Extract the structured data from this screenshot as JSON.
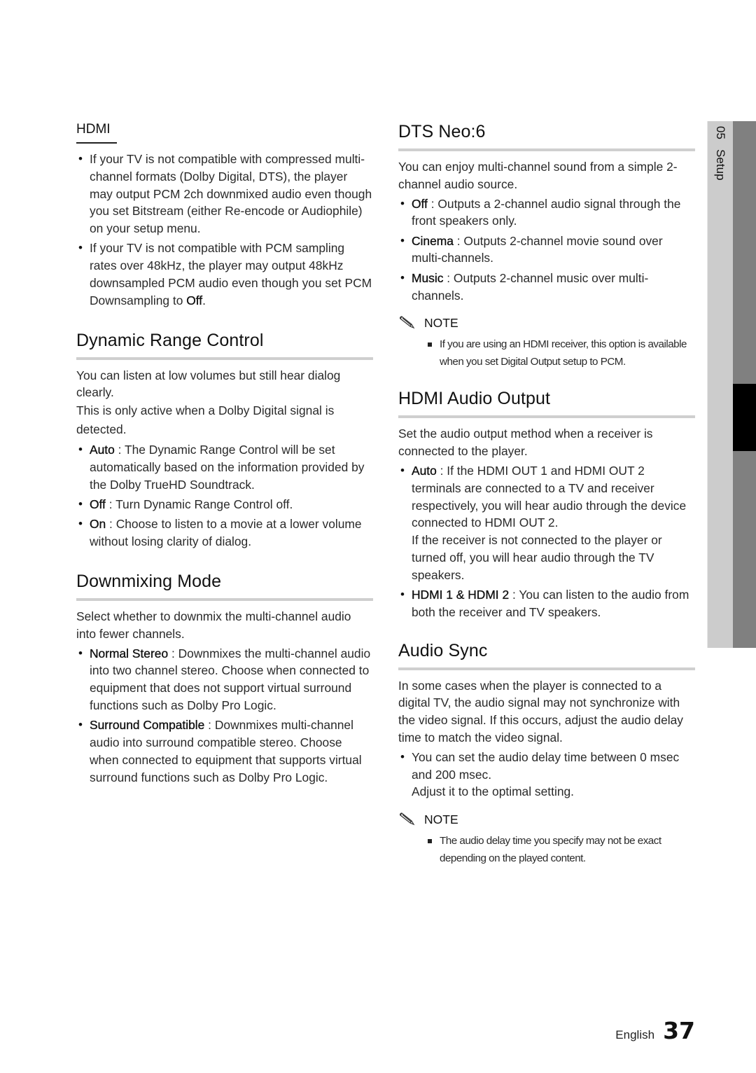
{
  "sidebar": {
    "chapter_number": "05",
    "chapter_title": "Setup"
  },
  "left": {
    "hdmi": {
      "title": "HDMI",
      "bullets": [
        {
          "text": "If your TV is not compatible with compressed multi-channel formats (Dolby Digital, DTS), the player may output PCM 2ch downmixed audio even though you set Bitstream (either Re-encode or Audiophile) on your setup menu."
        },
        {
          "text_before": "If your TV is not compatible with PCM sampling rates over 48kHz, the player may output 48kHz downsampled PCM audio even though you set PCM Downsampling to ",
          "bold": "Off",
          "text_after": "."
        }
      ]
    },
    "drc": {
      "title": "Dynamic Range Control",
      "intro1": "You can listen at low volumes but still hear dialog clearly.",
      "intro2": "This is only active when a Dolby Digital signal is detected.",
      "bullets": [
        {
          "term": "Auto",
          "desc": " : The Dynamic Range Control will be set automatically based on the information provided by the Dolby TrueHD Soundtrack."
        },
        {
          "term": "Off",
          "desc": " : Turn Dynamic Range Control off."
        },
        {
          "term": "On",
          "desc": " : Choose to listen to a movie at a lower volume without losing clarity of dialog."
        }
      ]
    },
    "downmix": {
      "title": "Downmixing Mode",
      "intro": "Select whether to downmix the multi-channel audio into fewer channels.",
      "bullets": [
        {
          "term": "Normal Stereo",
          "desc": " : Downmixes the multi-channel audio into two channel stereo. Choose when connected to equipment that does not support virtual surround functions such as Dolby Pro Logic."
        },
        {
          "term": "Surround Compatible",
          "desc": " : Downmixes multi-channel audio into surround compatible stereo. Choose when connected to equipment that supports virtual surround functions such as Dolby Pro Logic."
        }
      ]
    }
  },
  "right": {
    "dts": {
      "title": "DTS Neo:6",
      "intro": "You can enjoy multi-channel sound from a simple 2-channel audio source.",
      "bullets": [
        {
          "term": "Off",
          "desc": " : Outputs a 2-channel audio signal through the front speakers only."
        },
        {
          "term": "Cinema",
          "desc": " : Outputs 2-channel movie sound over multi-channels."
        },
        {
          "term": "Music",
          "desc": " : Outputs 2-channel music over multi-channels."
        }
      ],
      "note_label": "NOTE",
      "note_items": [
        "If you are using an HDMI receiver, this option is available when you set Digital Output setup to PCM."
      ]
    },
    "hdmi_audio": {
      "title": "HDMI Audio Output",
      "intro": "Set the audio output method when a receiver is connected to the player.",
      "bullets": [
        {
          "term": "Auto",
          "desc": " : If the HDMI OUT 1 and HDMI OUT 2 terminals are connected to a TV and receiver respectively, you will hear audio through the device connected to HDMI OUT 2.",
          "extra": "If the receiver is not connected to the player or turned off, you will hear audio through the TV speakers."
        },
        {
          "term": "HDMI 1 & HDMI 2",
          "desc": " : You can listen to the audio from both the receiver and TV speakers."
        }
      ]
    },
    "audio_sync": {
      "title": "Audio Sync",
      "intro": "In some cases when the player is connected to a digital TV, the audio signal may not synchronize with the video signal. If this occurs, adjust the audio delay time to match the video signal.",
      "bullets": [
        {
          "text": "You can set the audio delay time between 0 msec and 200 msec.",
          "extra": "Adjust it to the optimal setting."
        }
      ],
      "note_label": "NOTE",
      "note_items": [
        "The audio delay time you specify may not be exact depending on the played content."
      ]
    }
  },
  "footer": {
    "language": "English",
    "page_number": "37"
  }
}
